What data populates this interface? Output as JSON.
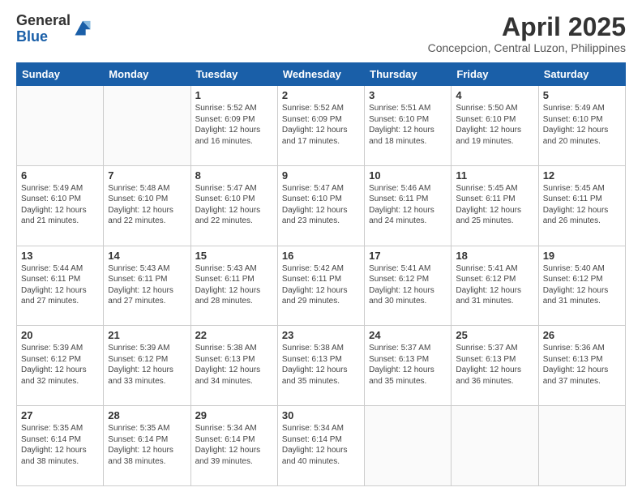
{
  "logo": {
    "general": "General",
    "blue": "Blue"
  },
  "header": {
    "month": "April 2025",
    "location": "Concepcion, Central Luzon, Philippines"
  },
  "weekdays": [
    "Sunday",
    "Monday",
    "Tuesday",
    "Wednesday",
    "Thursday",
    "Friday",
    "Saturday"
  ],
  "weeks": [
    [
      {
        "day": "",
        "info": ""
      },
      {
        "day": "",
        "info": ""
      },
      {
        "day": "1",
        "info": "Sunrise: 5:52 AM\nSunset: 6:09 PM\nDaylight: 12 hours and 16 minutes."
      },
      {
        "day": "2",
        "info": "Sunrise: 5:52 AM\nSunset: 6:09 PM\nDaylight: 12 hours and 17 minutes."
      },
      {
        "day": "3",
        "info": "Sunrise: 5:51 AM\nSunset: 6:10 PM\nDaylight: 12 hours and 18 minutes."
      },
      {
        "day": "4",
        "info": "Sunrise: 5:50 AM\nSunset: 6:10 PM\nDaylight: 12 hours and 19 minutes."
      },
      {
        "day": "5",
        "info": "Sunrise: 5:49 AM\nSunset: 6:10 PM\nDaylight: 12 hours and 20 minutes."
      }
    ],
    [
      {
        "day": "6",
        "info": "Sunrise: 5:49 AM\nSunset: 6:10 PM\nDaylight: 12 hours and 21 minutes."
      },
      {
        "day": "7",
        "info": "Sunrise: 5:48 AM\nSunset: 6:10 PM\nDaylight: 12 hours and 22 minutes."
      },
      {
        "day": "8",
        "info": "Sunrise: 5:47 AM\nSunset: 6:10 PM\nDaylight: 12 hours and 22 minutes."
      },
      {
        "day": "9",
        "info": "Sunrise: 5:47 AM\nSunset: 6:10 PM\nDaylight: 12 hours and 23 minutes."
      },
      {
        "day": "10",
        "info": "Sunrise: 5:46 AM\nSunset: 6:11 PM\nDaylight: 12 hours and 24 minutes."
      },
      {
        "day": "11",
        "info": "Sunrise: 5:45 AM\nSunset: 6:11 PM\nDaylight: 12 hours and 25 minutes."
      },
      {
        "day": "12",
        "info": "Sunrise: 5:45 AM\nSunset: 6:11 PM\nDaylight: 12 hours and 26 minutes."
      }
    ],
    [
      {
        "day": "13",
        "info": "Sunrise: 5:44 AM\nSunset: 6:11 PM\nDaylight: 12 hours and 27 minutes."
      },
      {
        "day": "14",
        "info": "Sunrise: 5:43 AM\nSunset: 6:11 PM\nDaylight: 12 hours and 27 minutes."
      },
      {
        "day": "15",
        "info": "Sunrise: 5:43 AM\nSunset: 6:11 PM\nDaylight: 12 hours and 28 minutes."
      },
      {
        "day": "16",
        "info": "Sunrise: 5:42 AM\nSunset: 6:11 PM\nDaylight: 12 hours and 29 minutes."
      },
      {
        "day": "17",
        "info": "Sunrise: 5:41 AM\nSunset: 6:12 PM\nDaylight: 12 hours and 30 minutes."
      },
      {
        "day": "18",
        "info": "Sunrise: 5:41 AM\nSunset: 6:12 PM\nDaylight: 12 hours and 31 minutes."
      },
      {
        "day": "19",
        "info": "Sunrise: 5:40 AM\nSunset: 6:12 PM\nDaylight: 12 hours and 31 minutes."
      }
    ],
    [
      {
        "day": "20",
        "info": "Sunrise: 5:39 AM\nSunset: 6:12 PM\nDaylight: 12 hours and 32 minutes."
      },
      {
        "day": "21",
        "info": "Sunrise: 5:39 AM\nSunset: 6:12 PM\nDaylight: 12 hours and 33 minutes."
      },
      {
        "day": "22",
        "info": "Sunrise: 5:38 AM\nSunset: 6:13 PM\nDaylight: 12 hours and 34 minutes."
      },
      {
        "day": "23",
        "info": "Sunrise: 5:38 AM\nSunset: 6:13 PM\nDaylight: 12 hours and 35 minutes."
      },
      {
        "day": "24",
        "info": "Sunrise: 5:37 AM\nSunset: 6:13 PM\nDaylight: 12 hours and 35 minutes."
      },
      {
        "day": "25",
        "info": "Sunrise: 5:37 AM\nSunset: 6:13 PM\nDaylight: 12 hours and 36 minutes."
      },
      {
        "day": "26",
        "info": "Sunrise: 5:36 AM\nSunset: 6:13 PM\nDaylight: 12 hours and 37 minutes."
      }
    ],
    [
      {
        "day": "27",
        "info": "Sunrise: 5:35 AM\nSunset: 6:14 PM\nDaylight: 12 hours and 38 minutes."
      },
      {
        "day": "28",
        "info": "Sunrise: 5:35 AM\nSunset: 6:14 PM\nDaylight: 12 hours and 38 minutes."
      },
      {
        "day": "29",
        "info": "Sunrise: 5:34 AM\nSunset: 6:14 PM\nDaylight: 12 hours and 39 minutes."
      },
      {
        "day": "30",
        "info": "Sunrise: 5:34 AM\nSunset: 6:14 PM\nDaylight: 12 hours and 40 minutes."
      },
      {
        "day": "",
        "info": ""
      },
      {
        "day": "",
        "info": ""
      },
      {
        "day": "",
        "info": ""
      }
    ]
  ]
}
